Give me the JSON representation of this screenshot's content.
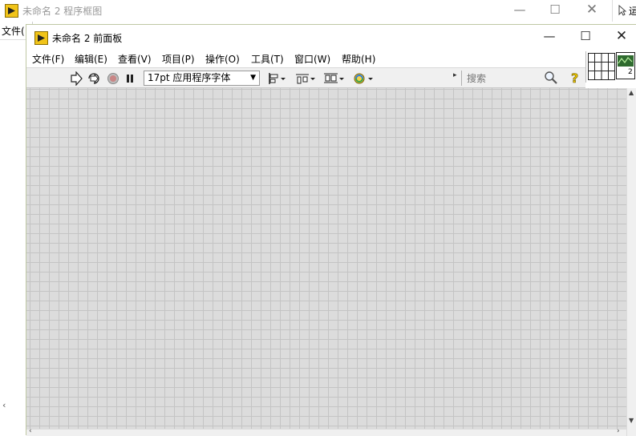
{
  "back_window": {
    "title": "未命名 2 程序框图",
    "menu_file": "文件(",
    "right_edge_text": "运"
  },
  "front_window": {
    "title": "未命名 2 前面板",
    "menu": [
      {
        "label": "文件(F)"
      },
      {
        "label": "编辑(E)"
      },
      {
        "label": "查看(V)"
      },
      {
        "label": "项目(P)"
      },
      {
        "label": "操作(O)"
      },
      {
        "label": "工具(T)"
      },
      {
        "label": "窗口(W)"
      },
      {
        "label": "帮助(H)"
      }
    ],
    "toolbar": {
      "font_select": "17pt 应用程序字体",
      "search_placeholder": "搜索"
    },
    "connector_number": "2"
  },
  "icons": {
    "window": [
      "labview-icon",
      "minimize-icon",
      "maximize-icon",
      "close-icon"
    ],
    "toolbar": [
      "run-arrow-icon",
      "run-continuously-icon",
      "abort-icon",
      "pause-icon",
      "align-objects-icon",
      "distribute-objects-icon",
      "resize-objects-icon",
      "reorder-icon",
      "search-icon",
      "context-help-icon"
    ]
  },
  "colors": {
    "labview_yellow": "#f1c419",
    "canvas": "#dcdcdc",
    "grid": "#c4c4c4",
    "toolbar": "#f0f0f0"
  }
}
